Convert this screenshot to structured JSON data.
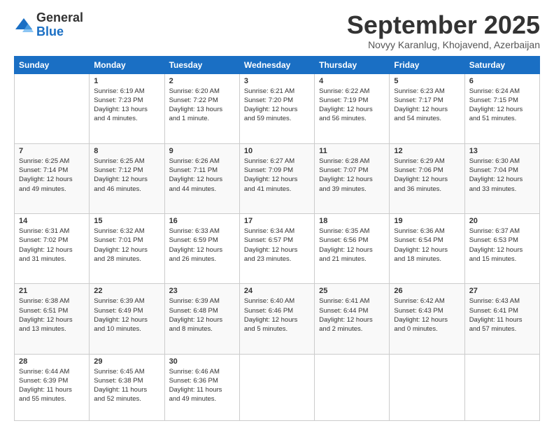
{
  "header": {
    "logo_general": "General",
    "logo_blue": "Blue",
    "month_title": "September 2025",
    "location": "Novyy Karanlug, Khojavend, Azerbaijan"
  },
  "columns": [
    "Sunday",
    "Monday",
    "Tuesday",
    "Wednesday",
    "Thursday",
    "Friday",
    "Saturday"
  ],
  "weeks": [
    [
      {
        "day": "",
        "info": ""
      },
      {
        "day": "1",
        "info": "Sunrise: 6:19 AM\nSunset: 7:23 PM\nDaylight: 13 hours\nand 4 minutes."
      },
      {
        "day": "2",
        "info": "Sunrise: 6:20 AM\nSunset: 7:22 PM\nDaylight: 13 hours\nand 1 minute."
      },
      {
        "day": "3",
        "info": "Sunrise: 6:21 AM\nSunset: 7:20 PM\nDaylight: 12 hours\nand 59 minutes."
      },
      {
        "day": "4",
        "info": "Sunrise: 6:22 AM\nSunset: 7:19 PM\nDaylight: 12 hours\nand 56 minutes."
      },
      {
        "day": "5",
        "info": "Sunrise: 6:23 AM\nSunset: 7:17 PM\nDaylight: 12 hours\nand 54 minutes."
      },
      {
        "day": "6",
        "info": "Sunrise: 6:24 AM\nSunset: 7:15 PM\nDaylight: 12 hours\nand 51 minutes."
      }
    ],
    [
      {
        "day": "7",
        "info": "Sunrise: 6:25 AM\nSunset: 7:14 PM\nDaylight: 12 hours\nand 49 minutes."
      },
      {
        "day": "8",
        "info": "Sunrise: 6:25 AM\nSunset: 7:12 PM\nDaylight: 12 hours\nand 46 minutes."
      },
      {
        "day": "9",
        "info": "Sunrise: 6:26 AM\nSunset: 7:11 PM\nDaylight: 12 hours\nand 44 minutes."
      },
      {
        "day": "10",
        "info": "Sunrise: 6:27 AM\nSunset: 7:09 PM\nDaylight: 12 hours\nand 41 minutes."
      },
      {
        "day": "11",
        "info": "Sunrise: 6:28 AM\nSunset: 7:07 PM\nDaylight: 12 hours\nand 39 minutes."
      },
      {
        "day": "12",
        "info": "Sunrise: 6:29 AM\nSunset: 7:06 PM\nDaylight: 12 hours\nand 36 minutes."
      },
      {
        "day": "13",
        "info": "Sunrise: 6:30 AM\nSunset: 7:04 PM\nDaylight: 12 hours\nand 33 minutes."
      }
    ],
    [
      {
        "day": "14",
        "info": "Sunrise: 6:31 AM\nSunset: 7:02 PM\nDaylight: 12 hours\nand 31 minutes."
      },
      {
        "day": "15",
        "info": "Sunrise: 6:32 AM\nSunset: 7:01 PM\nDaylight: 12 hours\nand 28 minutes."
      },
      {
        "day": "16",
        "info": "Sunrise: 6:33 AM\nSunset: 6:59 PM\nDaylight: 12 hours\nand 26 minutes."
      },
      {
        "day": "17",
        "info": "Sunrise: 6:34 AM\nSunset: 6:57 PM\nDaylight: 12 hours\nand 23 minutes."
      },
      {
        "day": "18",
        "info": "Sunrise: 6:35 AM\nSunset: 6:56 PM\nDaylight: 12 hours\nand 21 minutes."
      },
      {
        "day": "19",
        "info": "Sunrise: 6:36 AM\nSunset: 6:54 PM\nDaylight: 12 hours\nand 18 minutes."
      },
      {
        "day": "20",
        "info": "Sunrise: 6:37 AM\nSunset: 6:53 PM\nDaylight: 12 hours\nand 15 minutes."
      }
    ],
    [
      {
        "day": "21",
        "info": "Sunrise: 6:38 AM\nSunset: 6:51 PM\nDaylight: 12 hours\nand 13 minutes."
      },
      {
        "day": "22",
        "info": "Sunrise: 6:39 AM\nSunset: 6:49 PM\nDaylight: 12 hours\nand 10 minutes."
      },
      {
        "day": "23",
        "info": "Sunrise: 6:39 AM\nSunset: 6:48 PM\nDaylight: 12 hours\nand 8 minutes."
      },
      {
        "day": "24",
        "info": "Sunrise: 6:40 AM\nSunset: 6:46 PM\nDaylight: 12 hours\nand 5 minutes."
      },
      {
        "day": "25",
        "info": "Sunrise: 6:41 AM\nSunset: 6:44 PM\nDaylight: 12 hours\nand 2 minutes."
      },
      {
        "day": "26",
        "info": "Sunrise: 6:42 AM\nSunset: 6:43 PM\nDaylight: 12 hours\nand 0 minutes."
      },
      {
        "day": "27",
        "info": "Sunrise: 6:43 AM\nSunset: 6:41 PM\nDaylight: 11 hours\nand 57 minutes."
      }
    ],
    [
      {
        "day": "28",
        "info": "Sunrise: 6:44 AM\nSunset: 6:39 PM\nDaylight: 11 hours\nand 55 minutes."
      },
      {
        "day": "29",
        "info": "Sunrise: 6:45 AM\nSunset: 6:38 PM\nDaylight: 11 hours\nand 52 minutes."
      },
      {
        "day": "30",
        "info": "Sunrise: 6:46 AM\nSunset: 6:36 PM\nDaylight: 11 hours\nand 49 minutes."
      },
      {
        "day": "",
        "info": ""
      },
      {
        "day": "",
        "info": ""
      },
      {
        "day": "",
        "info": ""
      },
      {
        "day": "",
        "info": ""
      }
    ]
  ]
}
